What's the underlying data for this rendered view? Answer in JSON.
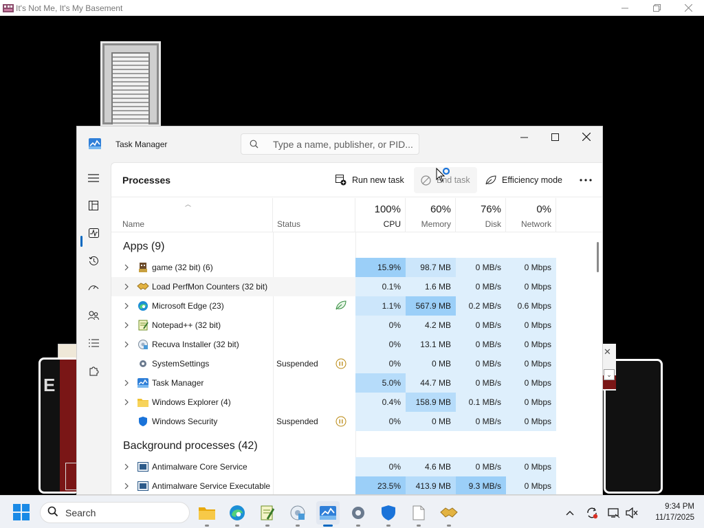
{
  "game_window": {
    "title": "It's Not Me, It's My Basement"
  },
  "task_manager": {
    "title": "Task Manager",
    "search_placeholder": "Type a name, publisher, or PID...",
    "page_title": "Processes",
    "toolbar": {
      "run_new_task": "Run new task",
      "end_task": "End task",
      "efficiency_mode": "Efficiency mode"
    },
    "columns": {
      "name": "Name",
      "status": "Status",
      "cpu": {
        "pct": "100%",
        "label": "CPU"
      },
      "memory": {
        "pct": "60%",
        "label": "Memory"
      },
      "disk": {
        "pct": "76%",
        "label": "Disk"
      },
      "network": {
        "pct": "0%",
        "label": "Network"
      }
    },
    "groups": {
      "apps": "Apps (9)",
      "background": "Background processes (42)"
    },
    "apps": [
      {
        "name": "game (32 bit) (6)",
        "status": "",
        "cpu": "15.9%",
        "memory": "98.7 MB",
        "disk": "0 MB/s",
        "network": "0 Mbps",
        "icon": "game-icon"
      },
      {
        "name": "Load PerfMon Counters (32 bit)",
        "status": "",
        "cpu": "0.1%",
        "memory": "1.6 MB",
        "disk": "0 MB/s",
        "network": "0 Mbps",
        "icon": "handshake-icon"
      },
      {
        "name": "Microsoft Edge (23)",
        "status": "",
        "cpu": "1.1%",
        "memory": "567.9 MB",
        "disk": "0.2 MB/s",
        "network": "0.6 Mbps",
        "icon": "edge-icon"
      },
      {
        "name": "Notepad++ (32 bit)",
        "status": "",
        "cpu": "0%",
        "memory": "4.2 MB",
        "disk": "0 MB/s",
        "network": "0 Mbps",
        "icon": "notepad-icon"
      },
      {
        "name": "Recuva Installer (32 bit)",
        "status": "",
        "cpu": "0%",
        "memory": "13.1 MB",
        "disk": "0 MB/s",
        "network": "0 Mbps",
        "icon": "installer-icon"
      },
      {
        "name": "SystemSettings",
        "status": "Suspended",
        "cpu": "0%",
        "memory": "0 MB",
        "disk": "0 MB/s",
        "network": "0 Mbps",
        "icon": "settings-gear-icon"
      },
      {
        "name": "Task Manager",
        "status": "",
        "cpu": "5.0%",
        "memory": "44.7 MB",
        "disk": "0 MB/s",
        "network": "0 Mbps",
        "icon": "task-manager-icon"
      },
      {
        "name": "Windows Explorer (4)",
        "status": "",
        "cpu": "0.4%",
        "memory": "158.9 MB",
        "disk": "0.1 MB/s",
        "network": "0 Mbps",
        "icon": "folder-icon"
      },
      {
        "name": "Windows Security",
        "status": "Suspended",
        "cpu": "0%",
        "memory": "0 MB",
        "disk": "0 MB/s",
        "network": "0 Mbps",
        "icon": "shield-icon"
      }
    ],
    "background": [
      {
        "name": "Antimalware Core Service",
        "status": "",
        "cpu": "0%",
        "memory": "4.6 MB",
        "disk": "0 MB/s",
        "network": "0 Mbps",
        "icon": "service-icon"
      },
      {
        "name": "Antimalware Service Executable",
        "status": "",
        "cpu": "23.5%",
        "memory": "413.9 MB",
        "disk": "9.3 MB/s",
        "network": "0 Mbps",
        "icon": "service-icon"
      }
    ]
  },
  "taskbar": {
    "search_label": "Search",
    "time": "9:34 PM",
    "date": "11/17/2025"
  },
  "colors": {
    "accent": "#0067c0",
    "heat_low": "#deeffc",
    "heat_mid": "#cce6fb",
    "heat_high": "#9bcff8"
  }
}
